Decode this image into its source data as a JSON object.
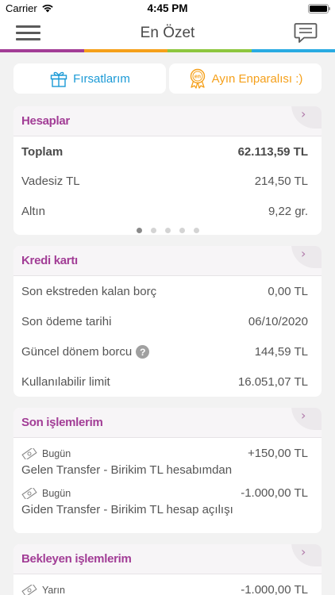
{
  "status_bar": {
    "carrier": "Carrier",
    "time": "4:45 PM"
  },
  "nav": {
    "title": "En Özet"
  },
  "stripe_colors": [
    "#a23d96",
    "#f5a01a",
    "#8dc63f",
    "#29abe2"
  ],
  "quick_actions": {
    "opportunities": "Fırsatlarım",
    "enpara": "Ayın Enparalısı :)",
    "enpara_badge": "en"
  },
  "accounts": {
    "title": "Hesaplar",
    "rows": [
      {
        "label": "Toplam",
        "value": "62.113,59 TL"
      },
      {
        "label": "Vadesiz TL",
        "value": "214,50 TL"
      },
      {
        "label": "Altın",
        "value": "9,22 gr."
      }
    ],
    "pager": {
      "count": 5,
      "active": 1
    }
  },
  "credit_card": {
    "title": "Kredi kartı",
    "rows": [
      {
        "label": "Son ekstreden kalan borç",
        "value": "0,00 TL"
      },
      {
        "label": "Son ödeme tarihi",
        "value": "06/10/2020"
      },
      {
        "label": "Güncel dönem borcu",
        "value": "144,59 TL"
      },
      {
        "label": "Kullanılabilir limit",
        "value": "16.051,07 TL"
      }
    ],
    "help_symbol": "?"
  },
  "recent_transactions": {
    "title": "Son işlemlerim",
    "items": [
      {
        "date": "Bugün",
        "amount": "+150,00 TL",
        "description": "Gelen Transfer - Birikim TL hesabımdan"
      },
      {
        "date": "Bugün",
        "amount": "-1.000,00 TL",
        "description": "Giden Transfer - Birikim TL hesap açılışı"
      }
    ]
  },
  "pending_transactions": {
    "title": "Bekleyen işlemlerim",
    "items": [
      {
        "date": "Yarın",
        "amount": "-1.000,00 TL"
      }
    ]
  },
  "icons": {
    "menu": "hamburger-icon",
    "messages": "speech-bubble-icon",
    "gift": "gift-icon",
    "award": "award-ribbon-icon",
    "chevron": "chevron-right-icon",
    "money": "banknote-icon",
    "help": "question-circle-icon"
  },
  "chevron_symbol": "›"
}
